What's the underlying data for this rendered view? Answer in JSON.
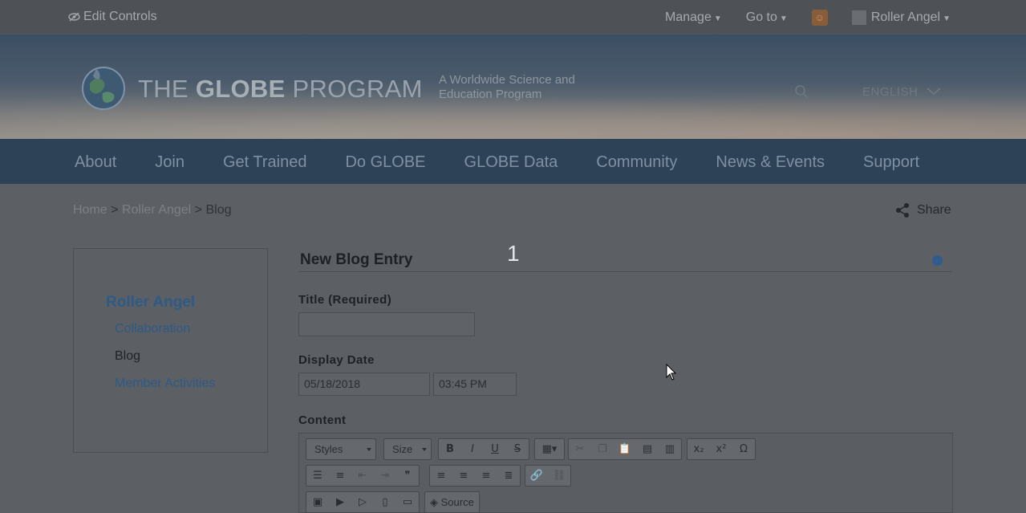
{
  "topbar": {
    "edit_controls": "Edit Controls",
    "manage": "Manage",
    "goto": "Go to",
    "user": "Roller Angel"
  },
  "banner": {
    "brand_prefix": "THE",
    "brand_bold": "GLOBE",
    "brand_suffix": "PROGRAM",
    "tagline_line1": "A Worldwide Science and",
    "tagline_line2": "Education Program",
    "language": "ENGLISH"
  },
  "nav": [
    "About",
    "Join",
    "Get Trained",
    "Do GLOBE",
    "GLOBE Data",
    "Community",
    "News & Events",
    "Support"
  ],
  "breadcrumb": {
    "home": "Home",
    "sep": ">",
    "user": "Roller Angel",
    "current": "Blog"
  },
  "share": "Share",
  "sidebar": {
    "title": "Roller Angel",
    "items": [
      "Collaboration",
      "Blog",
      "Member Activities"
    ]
  },
  "main": {
    "title": "New Blog Entry",
    "step": "1",
    "title_label": "Title (Required)",
    "title_value": "",
    "date_label": "Display Date",
    "date_value": "05/18/2018",
    "time_value": "03:45 PM",
    "content_label": "Content"
  },
  "editor": {
    "styles": "Styles",
    "size": "Size",
    "bold": "B",
    "italic": "I",
    "underline": "U",
    "strike": "S",
    "source": "Source"
  },
  "colors": {
    "nav_bg": "#2d4257",
    "link": "#2c5a88",
    "accent_badge": "#8a5d3a"
  }
}
